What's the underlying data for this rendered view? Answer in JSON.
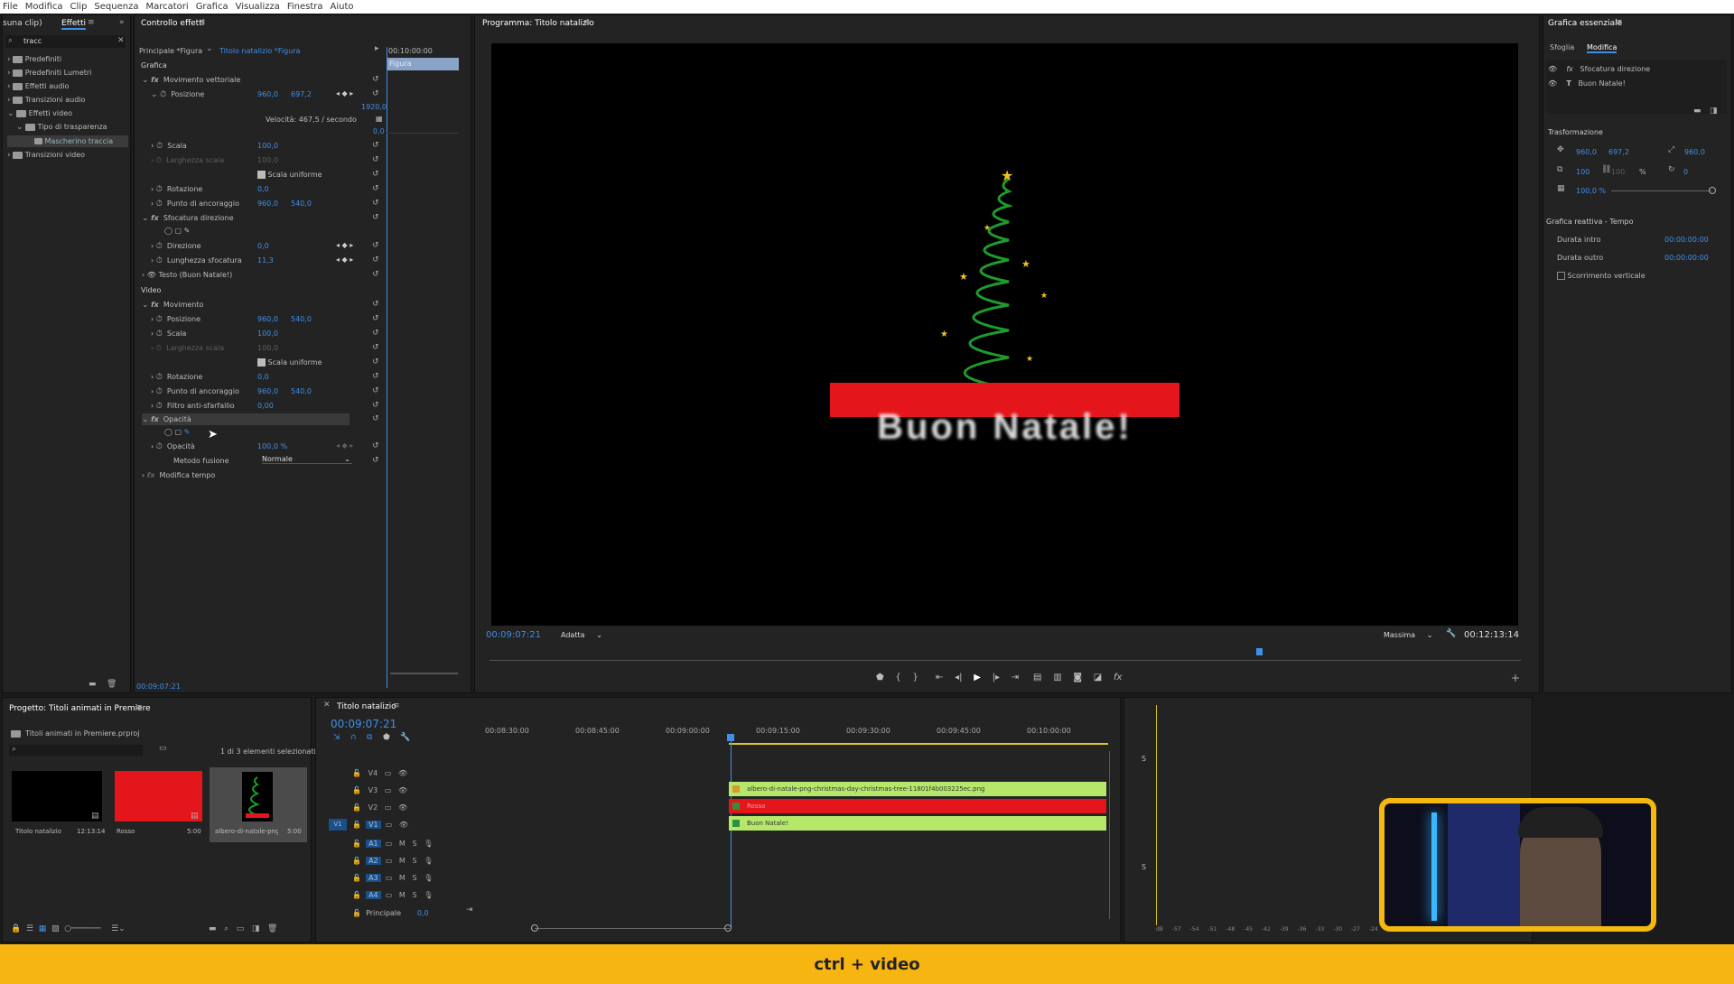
{
  "menubar": {
    "items": [
      "File",
      "Modifica",
      "Clip",
      "Sequenza",
      "Marcatori",
      "Grafica",
      "Visualizza",
      "Finestra",
      "Aiuto"
    ]
  },
  "effects_panel": {
    "tab_prev": "suna clip)",
    "tab_active": "Effetti",
    "search_value": "tracc",
    "tree": [
      "Predefiniti",
      "Predefiniti Lumetri",
      "Effetti audio",
      "Transizioni audio",
      "Effetti video",
      "Tipo di trasparenza",
      "Mascherino traccia",
      "Transizioni video"
    ]
  },
  "effect_controls": {
    "title": "Controllo effetti",
    "source": "Principale *Figura",
    "clip": "Titolo natalizio *Figura",
    "timecode_head": "00:10:00:00",
    "clip_label": "Figura",
    "section_graphics": "Grafica",
    "vector_motion": "Movimento vettoriale",
    "position_label": "Posizione",
    "pos_x": "960,0",
    "pos_y": "697,2",
    "graph_top": "1920,0",
    "speed": "Velocità: 467,5 / secondo",
    "graph_bottom": "0,0",
    "scale_label": "Scala",
    "scale": "100,0",
    "scale_width_label": "Larghezza scala",
    "scale_width": "100,0",
    "uniform_scale": "Scala uniforme",
    "rotation_label": "Rotazione",
    "rotation": "0,0",
    "anchor_label": "Punto di ancoraggio",
    "anchor_x": "960,0",
    "anchor_y": "540,0",
    "directional_blur": "Sfocatura direzione",
    "direction_label": "Direzione",
    "direction": "0,0",
    "blur_length_label": "Lunghezza sfocatura",
    "blur_length": "11,3",
    "text_layer": "Testo (Buon Natale!)",
    "section_video": "Video",
    "motion": "Movimento",
    "v_pos_x": "960,0",
    "v_pos_y": "540,0",
    "v_scale": "100,0",
    "v_scale_width": "100,0",
    "v_rotation": "0,0",
    "v_anchor_x": "960,0",
    "v_anchor_y": "540,0",
    "anti_flicker_label": "Filtro anti-sfarfallio",
    "anti_flicker": "0,00",
    "opacity_section": "Opacità",
    "opacity_label": "Opacità",
    "opacity": "100,0 %",
    "blend_label": "Metodo fusione",
    "blend": "Normale",
    "time_remap": "Modifica tempo",
    "footer_timecode": "00:09:07:21"
  },
  "program_monitor": {
    "title": "Programma: Titolo natalizio",
    "timecode": "00:09:07:21",
    "fit": "Adatta",
    "quality": "Massima",
    "duration": "00:12:13:14",
    "title_text": "Buon Natale!"
  },
  "essential_graphics": {
    "title": "Grafica essenziale",
    "tab_browse": "Sfoglia",
    "tab_edit": "Modifica",
    "layers": [
      "Sfocatura direzione",
      "Buon Natale!"
    ],
    "transform_title": "Trasformazione",
    "pos_x": "960,0",
    "pos_y": "697,2",
    "anchor_x": "960,0",
    "scale": "100",
    "scale2": "100",
    "scale_unit": "%",
    "rotation": "0",
    "opacity": "100,0 %",
    "responsive_title": "Grafica reattiva - Tempo",
    "intro_label": "Durata intro",
    "intro_value": "00:00:00:00",
    "outro_label": "Durata outro",
    "outro_value": "00:00:00:00",
    "scroll_label": "Scorrimento verticale"
  },
  "project_panel": {
    "title": "Progetto: Titoli animati in Premiere",
    "file": "Titoli animati in Premiere.prproj",
    "selection": "1 di 3 elementi selezionati",
    "items": [
      {
        "name": "Titolo natalizio",
        "duration": "12:13:14"
      },
      {
        "name": "Rosso",
        "duration": "5:00"
      },
      {
        "name": "albero-di-natale-png-ch...",
        "duration": "5:00"
      }
    ]
  },
  "timeline": {
    "title": "Titolo natalizio",
    "timecode": "00:09:07:21",
    "ruler": [
      "00:08:30:00",
      "00:08:45:00",
      "00:09:00:00",
      "00:09:15:00",
      "00:09:30:00",
      "00:09:45:00",
      "00:10:00:00"
    ],
    "video_tracks": [
      "V4",
      "V3",
      "V2",
      "V1"
    ],
    "audio_tracks": [
      "A1",
      "A2",
      "A3",
      "A4"
    ],
    "source_patch": "V1",
    "master_label": "Principale",
    "master_value": "0,0",
    "clip_v3": "albero-di-natale-png-christmas-day-christmas-tree-11801f4b003225ec.png",
    "clip_v2": "Rosso",
    "clip_v1": "Buon Natale!",
    "track_buttons": {
      "mute": "M",
      "solo": "S"
    }
  },
  "audio_meter": {
    "scale": [
      "dB",
      "-57",
      "-54",
      "-51",
      "-48",
      "-45",
      "-42",
      "-39",
      "-36",
      "-33",
      "-30",
      "-27",
      "-24"
    ],
    "solo": "S"
  },
  "caption": "ctrl + video",
  "colors": {
    "accent": "#3f8fe8",
    "caption_bg": "#f7b512",
    "clip_green": "#b5e86a",
    "clip_red": "#e4161b",
    "webcam_border": "#f5b80f"
  }
}
